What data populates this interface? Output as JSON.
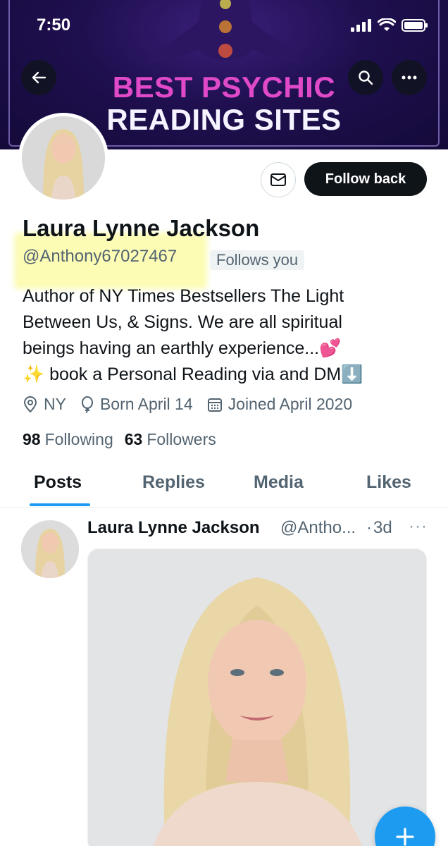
{
  "status_bar": {
    "time": "7:50"
  },
  "banner": {
    "line1": "BEST PSYCHIC",
    "line2": "READING SITES",
    "title_color": "#e04ac9"
  },
  "header_buttons": {
    "back_icon": "arrow-left-icon",
    "search_icon": "search-icon",
    "more_icon": "more-horizontal-icon"
  },
  "profile": {
    "name": "Laura Lynne Jackson",
    "handle": "@Anthony67027467",
    "follows_you": "Follows you",
    "follow_button": "Follow back",
    "bio_line1": "Author of NY Times Bestsellers The Light",
    "bio_line2": "Between Us, & Signs. We are all spiritual",
    "bio_line3": "beings having an earthly experience...💕",
    "bio_line4": "✨ book a Personal Reading via and DM⬇️",
    "location": "NY",
    "born": "Born April 14",
    "joined": "Joined April 2020",
    "following_count": "98",
    "following_label": "Following",
    "followers_count": "63",
    "followers_label": "Followers"
  },
  "tabs": [
    {
      "label": "Posts",
      "active": true
    },
    {
      "label": "Replies",
      "active": false
    },
    {
      "label": "Media",
      "active": false
    },
    {
      "label": "Likes",
      "active": false
    }
  ],
  "post": {
    "author": "Laura Lynne Jackson",
    "handle": "@Antho...",
    "dot": "·",
    "time": "3d",
    "more": "···"
  },
  "colors": {
    "accent": "#1d9bf0",
    "text_primary": "#0f1419",
    "text_secondary": "#536471"
  }
}
